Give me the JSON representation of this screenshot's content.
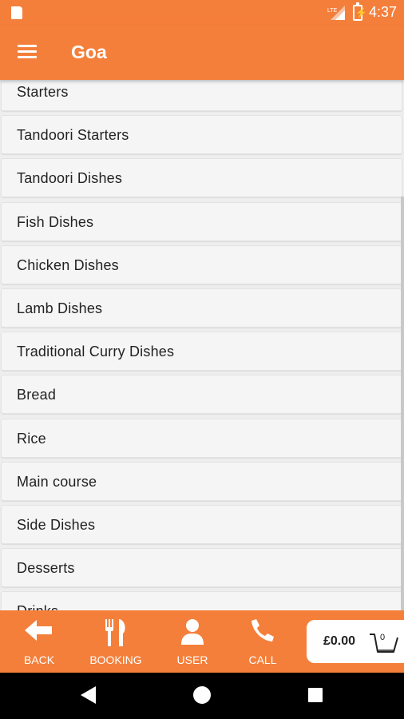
{
  "status_bar": {
    "time": "4:37",
    "network": "LTE"
  },
  "app_bar": {
    "title": "Goa"
  },
  "categories": [
    "Starters",
    "Tandoori Starters",
    "Tandoori Dishes",
    "Fish Dishes",
    "Chicken Dishes",
    "Lamb Dishes",
    "Traditional Curry Dishes",
    "Bread",
    "Rice",
    "Main course",
    "Side Dishes",
    "Desserts",
    "Drinks"
  ],
  "bottom_nav": {
    "back": "BACK",
    "booking": "BOOKING",
    "user": "USER",
    "call": "CALL"
  },
  "cart": {
    "total": "£0.00",
    "count": "0"
  },
  "colors": {
    "brand": "#f47f3b",
    "background": "#eeeeee",
    "card": "#f5f5f5"
  }
}
